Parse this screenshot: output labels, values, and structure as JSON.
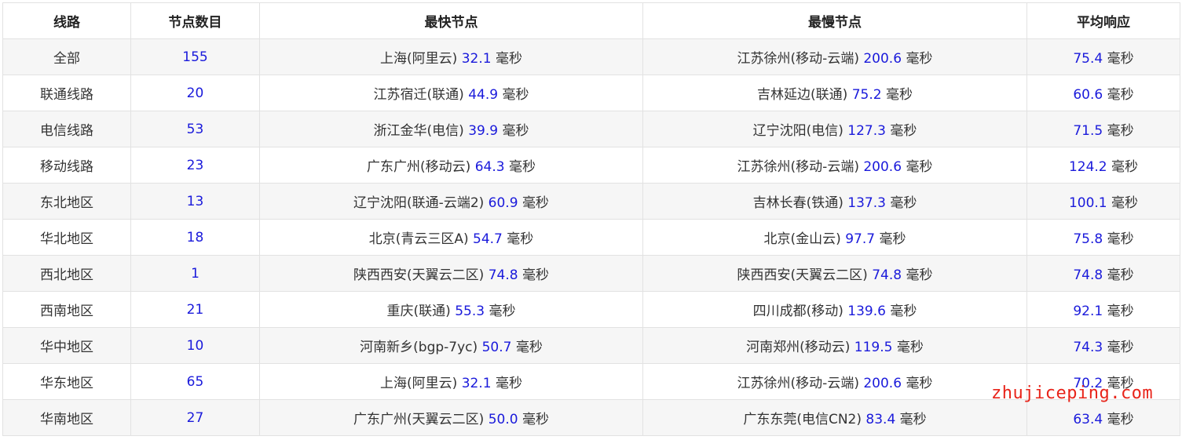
{
  "headers": [
    "线路",
    "节点数目",
    "最快节点",
    "最慢节点",
    "平均响应"
  ],
  "unit": "毫秒",
  "rows": [
    {
      "route": "全部",
      "count": "155",
      "fast_loc": "上海(阿里云)",
      "fast_val": "32.1",
      "slow_loc": "江苏徐州(移动-云端)",
      "slow_val": "200.6",
      "avg": "75.4"
    },
    {
      "route": "联通线路",
      "count": "20",
      "fast_loc": "江苏宿迁(联通)",
      "fast_val": "44.9",
      "slow_loc": "吉林延边(联通)",
      "slow_val": "75.2",
      "avg": "60.6"
    },
    {
      "route": "电信线路",
      "count": "53",
      "fast_loc": "浙江金华(电信)",
      "fast_val": "39.9",
      "slow_loc": "辽宁沈阳(电信)",
      "slow_val": "127.3",
      "avg": "71.5"
    },
    {
      "route": "移动线路",
      "count": "23",
      "fast_loc": "广东广州(移动云)",
      "fast_val": "64.3",
      "slow_loc": "江苏徐州(移动-云端)",
      "slow_val": "200.6",
      "avg": "124.2"
    },
    {
      "route": "东北地区",
      "count": "13",
      "fast_loc": "辽宁沈阳(联通-云端2)",
      "fast_val": "60.9",
      "slow_loc": "吉林长春(铁通)",
      "slow_val": "137.3",
      "avg": "100.1"
    },
    {
      "route": "华北地区",
      "count": "18",
      "fast_loc": "北京(青云三区A)",
      "fast_val": "54.7",
      "slow_loc": "北京(金山云)",
      "slow_val": "97.7",
      "avg": "75.8"
    },
    {
      "route": "西北地区",
      "count": "1",
      "fast_loc": "陕西西安(天翼云二区)",
      "fast_val": "74.8",
      "slow_loc": "陕西西安(天翼云二区)",
      "slow_val": "74.8",
      "avg": "74.8"
    },
    {
      "route": "西南地区",
      "count": "21",
      "fast_loc": "重庆(联通)",
      "fast_val": "55.3",
      "slow_loc": "四川成都(移动)",
      "slow_val": "139.6",
      "avg": "92.1"
    },
    {
      "route": "华中地区",
      "count": "10",
      "fast_loc": "河南新乡(bgp-7yc)",
      "fast_val": "50.7",
      "slow_loc": "河南郑州(移动云)",
      "slow_val": "119.5",
      "avg": "74.3"
    },
    {
      "route": "华东地区",
      "count": "65",
      "fast_loc": "上海(阿里云)",
      "fast_val": "32.1",
      "slow_loc": "江苏徐州(移动-云端)",
      "slow_val": "200.6",
      "avg": "70.2"
    },
    {
      "route": "华南地区",
      "count": "27",
      "fast_loc": "广东广州(天翼云二区)",
      "fast_val": "50.0",
      "slow_loc": "广东东莞(电信CN2)",
      "slow_val": "83.4",
      "avg": "63.4"
    }
  ],
  "watermark": "zhujiceping.com",
  "colors": {
    "number": "#1a1adb",
    "watermark": "#e8241a",
    "stripe": "#f6f6f6",
    "border": "#e2e2e2"
  }
}
